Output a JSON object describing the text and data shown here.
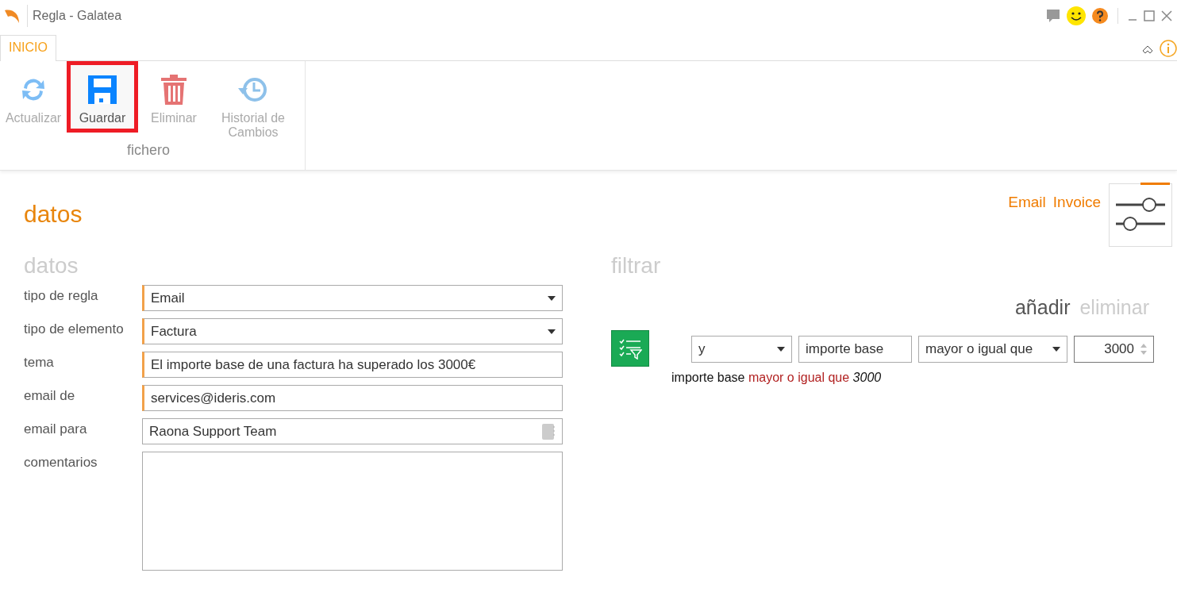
{
  "window": {
    "title": "Regla - Galatea"
  },
  "tabs": [
    {
      "label": "INICIO",
      "selected": true
    }
  ],
  "ribbon": {
    "group": "fichero",
    "buttons": [
      {
        "label": "Actualizar",
        "kind": "refresh",
        "disabled": true,
        "highlighted": false
      },
      {
        "label": "Guardar",
        "kind": "save",
        "disabled": false,
        "highlighted": true
      },
      {
        "label": "Eliminar",
        "kind": "delete",
        "disabled": true,
        "highlighted": false
      },
      {
        "label": "Historial de Cambios",
        "kind": "history",
        "disabled": true,
        "highlighted": false
      }
    ]
  },
  "page": {
    "title": "datos",
    "tags": [
      "Email",
      "Invoice"
    ]
  },
  "datos": {
    "title": "datos",
    "fields": [
      {
        "label": "tipo de regla",
        "kind": "select",
        "value": "Email",
        "required": true
      },
      {
        "label": "tipo de elemento",
        "kind": "select",
        "value": "Factura",
        "required": true
      },
      {
        "label": "tema",
        "kind": "text",
        "value": "El importe base de una factura ha superado los 3000€",
        "required": true
      },
      {
        "label": "email de",
        "kind": "text",
        "value": "services@ideris.com",
        "required": true
      },
      {
        "label": "email para",
        "kind": "lookup",
        "value": "Raona Support Team",
        "required": false
      },
      {
        "label": "comentarios",
        "kind": "textarea",
        "required": false
      }
    ]
  },
  "filtrar": {
    "title": "filtrar",
    "actions": [
      {
        "label": "añadir",
        "disabled": false
      },
      {
        "label": "eliminar",
        "disabled": true
      }
    ],
    "condition": {
      "connector": "y",
      "field": "importe base",
      "operator": "mayor o igual que",
      "value": "3000"
    },
    "summary": {
      "field": "importe base",
      "operator": "mayor o igual que",
      "value": "3000"
    }
  }
}
